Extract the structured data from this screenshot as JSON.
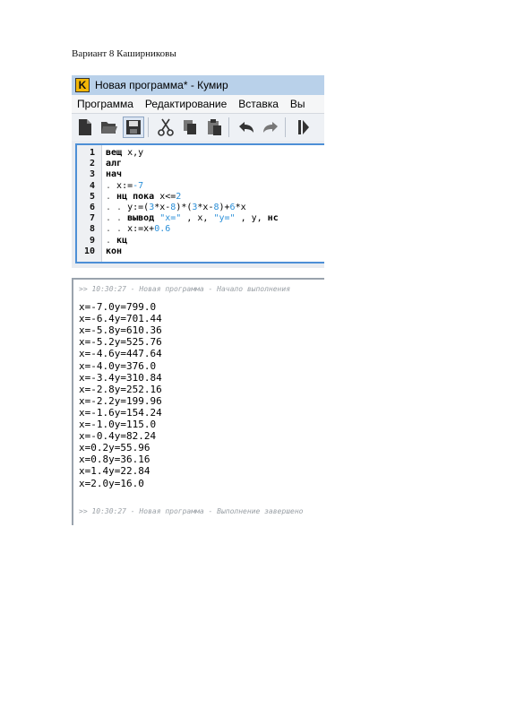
{
  "document": {
    "title": "Вариант 8 Каширниковы"
  },
  "window": {
    "logo_letter": "K",
    "title": "Новая программа* - Кумир"
  },
  "menu": {
    "items": [
      "Программа",
      "Редактирование",
      "Вставка",
      "Вы"
    ]
  },
  "toolbar": {
    "icons": [
      "new-file-icon",
      "open-folder-icon",
      "save-icon",
      "cut-icon",
      "copy-icon",
      "paste-icon",
      "undo-icon",
      "redo-icon",
      "run-icon"
    ]
  },
  "editor": {
    "line_numbers": [
      "1",
      "2",
      "3",
      "4",
      "5",
      "6",
      "7",
      "8",
      "9",
      "10"
    ],
    "lines": [
      [
        {
          "t": "вещ",
          "c": "kw"
        },
        {
          "t": " x,y",
          "c": ""
        }
      ],
      [
        {
          "t": "алг",
          "c": "kw"
        }
      ],
      [
        {
          "t": "нач",
          "c": "kw"
        }
      ],
      [
        {
          "t": ". ",
          "c": "dot"
        },
        {
          "t": "x:=",
          "c": ""
        },
        {
          "t": "-7",
          "c": "num"
        }
      ],
      [
        {
          "t": ". ",
          "c": "dot"
        },
        {
          "t": "нц пока",
          "c": "kw"
        },
        {
          "t": " x<=",
          "c": ""
        },
        {
          "t": "2",
          "c": "num"
        }
      ],
      [
        {
          "t": ". . ",
          "c": "dot"
        },
        {
          "t": "y:=(",
          "c": ""
        },
        {
          "t": "3",
          "c": "num"
        },
        {
          "t": "*x-",
          "c": ""
        },
        {
          "t": "8",
          "c": "num"
        },
        {
          "t": ")*(",
          "c": ""
        },
        {
          "t": "3",
          "c": "num"
        },
        {
          "t": "*x-",
          "c": ""
        },
        {
          "t": "8",
          "c": "num"
        },
        {
          "t": ")+",
          "c": ""
        },
        {
          "t": "6",
          "c": "num"
        },
        {
          "t": "*x",
          "c": ""
        }
      ],
      [
        {
          "t": ". . ",
          "c": "dot"
        },
        {
          "t": "вывод",
          "c": "kw"
        },
        {
          "t": " ",
          "c": ""
        },
        {
          "t": "\"x=\"",
          "c": "str"
        },
        {
          "t": " , x, ",
          "c": ""
        },
        {
          "t": "\"y=\"",
          "c": "str"
        },
        {
          "t": " , y, ",
          "c": ""
        },
        {
          "t": "нс",
          "c": "kw"
        }
      ],
      [
        {
          "t": ". . ",
          "c": "dot"
        },
        {
          "t": "x:=x+",
          "c": ""
        },
        {
          "t": "0.6",
          "c": "num"
        }
      ],
      [
        {
          "t": ". ",
          "c": "dot"
        },
        {
          "t": "кц",
          "c": "kw"
        }
      ],
      [
        {
          "t": "кон",
          "c": "kw"
        }
      ]
    ]
  },
  "console": {
    "start_message": ">> 10:30:27 - Новая программа - Начало выполнения",
    "end_message": ">> 10:30:27 - Новая программа - Выполнение завершено",
    "output": [
      "x=-7.0y=799.0",
      "x=-6.4y=701.44",
      "x=-5.8y=610.36",
      "x=-5.2y=525.76",
      "x=-4.6y=447.64",
      "x=-4.0y=376.0",
      "x=-3.4y=310.84",
      "x=-2.8y=252.16",
      "x=-2.2y=199.96",
      "x=-1.6y=154.24",
      "x=-1.0y=115.0",
      "x=-0.4y=82.24",
      "x=0.2y=55.96",
      "x=0.8y=36.16",
      "x=1.4y=22.84",
      "x=2.0y=16.0"
    ]
  }
}
